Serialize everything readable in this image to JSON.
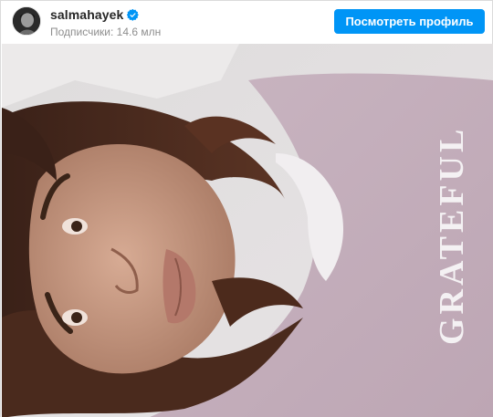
{
  "post": {
    "username": "salmahayek",
    "verified": true,
    "followers_text": "Подписчики: 14.6 млн",
    "profile_button_label": "Посмотреть профиль",
    "photo_shirt_text": "GRATEFUL"
  },
  "icons": {
    "verified": "verified-badge-icon",
    "avatar": "profile-avatar"
  },
  "colors": {
    "accent": "#0095f6",
    "username": "#262626",
    "muted": "#8e8e8e",
    "border": "#dbdbdb"
  }
}
